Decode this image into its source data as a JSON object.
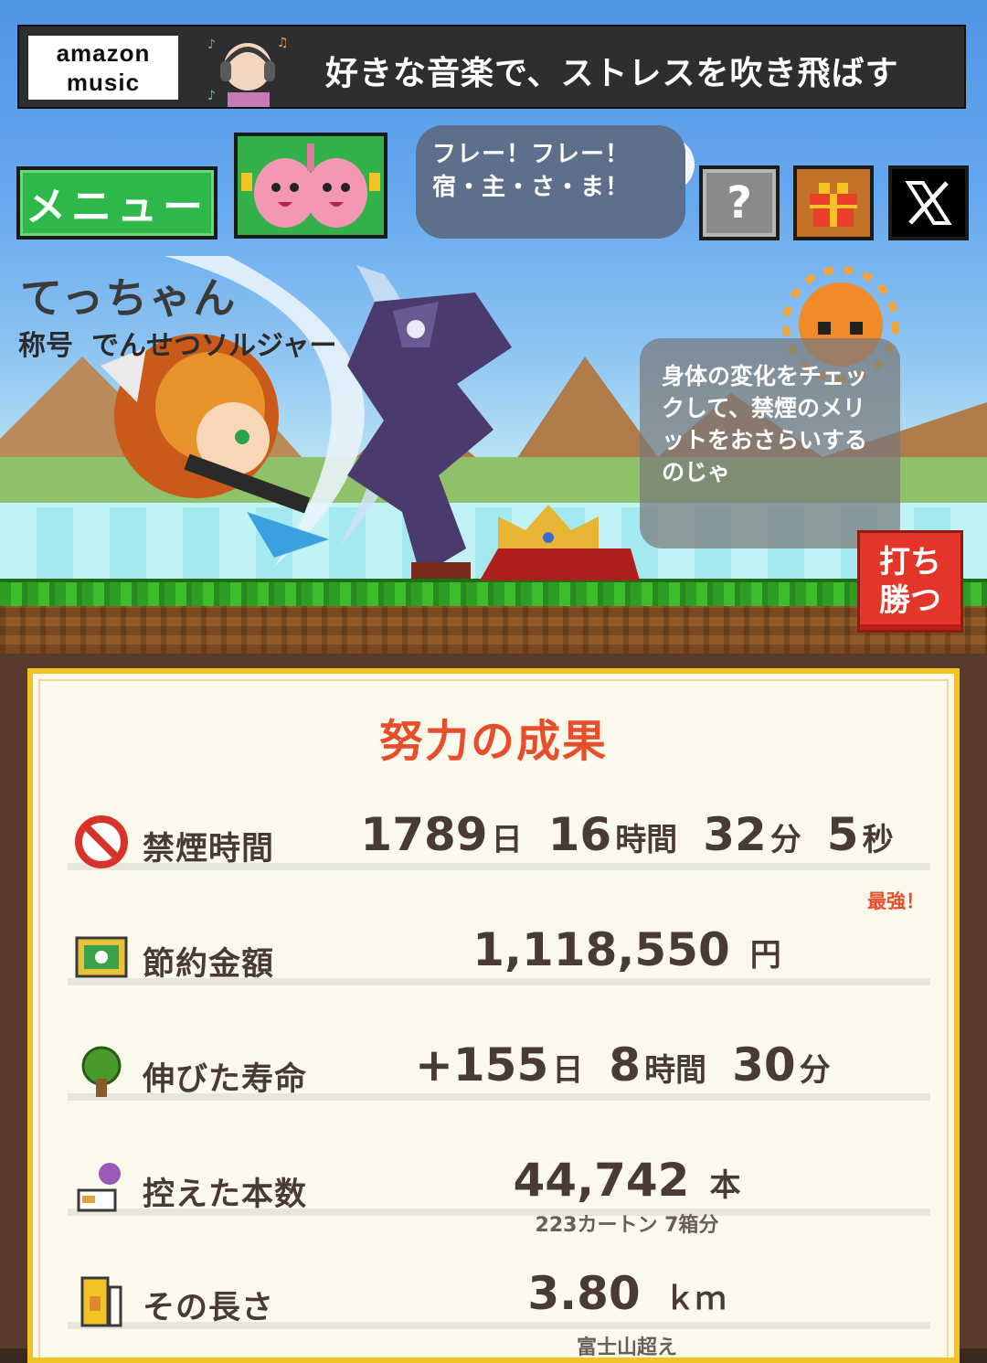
{
  "ad": {
    "logo_line1": "amazon",
    "logo_line2": "music",
    "text": "好きな音楽で、ストレスを吹き飛ばす"
  },
  "toolbar": {
    "menu_label": "メニュー",
    "cheer_text": "フレー！フレー！宿・主・さ・ま！",
    "help_label": "?",
    "icons": [
      "gift-icon",
      "x-logo-icon"
    ]
  },
  "player": {
    "name": "てっちゃん",
    "title_label": "称号",
    "title_value": "でんせつソルジャー"
  },
  "tip": {
    "text": "身体の変化をチェックして、禁煙のメリットをおさらいするのじゃ"
  },
  "win_button": {
    "line1": "打ち",
    "line2": "勝つ"
  },
  "results": {
    "title": "努力の成果",
    "quit_time": {
      "label": "禁煙時間",
      "days": "1789",
      "days_unit": "日",
      "hours": "16",
      "hours_unit": "時間",
      "minutes": "32",
      "minutes_unit": "分",
      "seconds": "5",
      "seconds_unit": "秒",
      "badge": "最強！"
    },
    "money_saved": {
      "label": "節約金額",
      "value": "1,118,550",
      "unit": "円"
    },
    "life_extended": {
      "label": "伸びた寿命",
      "days": "+155",
      "days_unit": "日",
      "hours": "8",
      "hours_unit": "時間",
      "minutes": "30",
      "minutes_unit": "分"
    },
    "cigarettes_avoided": {
      "label": "控えた本数",
      "value": "44,742",
      "unit": "本",
      "sub": "223カートン 7箱分"
    },
    "length": {
      "label": "その長さ",
      "value": "3.80",
      "unit": "ｋｍ",
      "sub": "富士山超え"
    }
  },
  "colors": {
    "accent_red": "#e84e2c",
    "menu_green": "#2fb84a",
    "panel_border": "#f2c325",
    "text_dark": "#4a3a34"
  }
}
